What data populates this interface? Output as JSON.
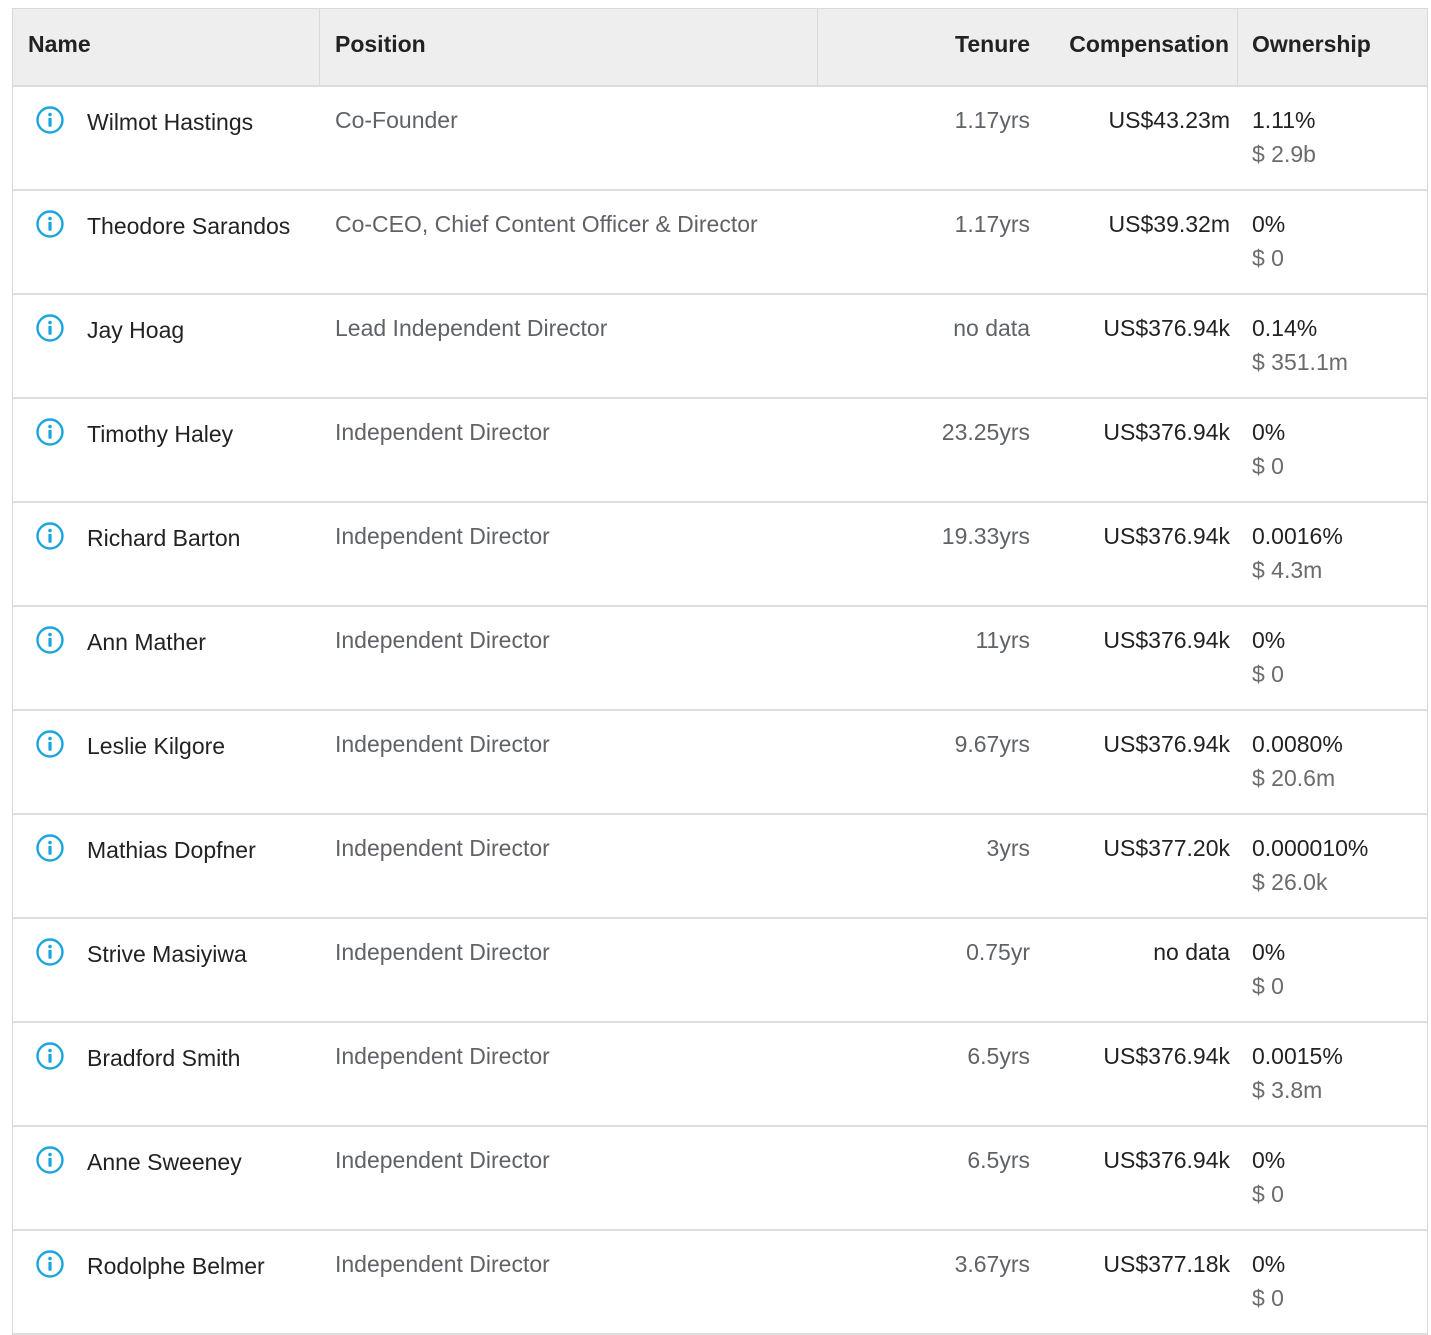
{
  "columns": {
    "name": "Name",
    "position": "Position",
    "tenure": "Tenure",
    "compensation": "Compensation",
    "ownership": "Ownership"
  },
  "colors": {
    "info_icon": "#1ca5dc"
  },
  "icons": {
    "info": "info-circle-icon"
  },
  "rows": [
    {
      "name": "Wilmot Hastings",
      "position": "Co-Founder",
      "tenure": "1.17yrs",
      "compensation": "US$43.23m",
      "ownership_pct": "1.11%",
      "ownership_value": "$ 2.9b"
    },
    {
      "name": "Theodore Sarandos",
      "position": "Co-CEO, Chief Content Officer & Director",
      "tenure": "1.17yrs",
      "compensation": "US$39.32m",
      "ownership_pct": "0%",
      "ownership_value": "$ 0"
    },
    {
      "name": "Jay Hoag",
      "position": "Lead Independent Director",
      "tenure": "no data",
      "compensation": "US$376.94k",
      "ownership_pct": "0.14%",
      "ownership_value": "$ 351.1m"
    },
    {
      "name": "Timothy Haley",
      "position": "Independent Director",
      "tenure": "23.25yrs",
      "compensation": "US$376.94k",
      "ownership_pct": "0%",
      "ownership_value": "$ 0"
    },
    {
      "name": "Richard Barton",
      "position": "Independent Director",
      "tenure": "19.33yrs",
      "compensation": "US$376.94k",
      "ownership_pct": "0.0016%",
      "ownership_value": "$ 4.3m"
    },
    {
      "name": "Ann Mather",
      "position": "Independent Director",
      "tenure": "11yrs",
      "compensation": "US$376.94k",
      "ownership_pct": "0%",
      "ownership_value": "$ 0"
    },
    {
      "name": "Leslie Kilgore",
      "position": "Independent Director",
      "tenure": "9.67yrs",
      "compensation": "US$376.94k",
      "ownership_pct": "0.0080%",
      "ownership_value": "$ 20.6m"
    },
    {
      "name": "Mathias Dopfner",
      "position": "Independent Director",
      "tenure": "3yrs",
      "compensation": "US$377.20k",
      "ownership_pct": "0.000010%",
      "ownership_value": "$ 26.0k"
    },
    {
      "name": "Strive Masiyiwa",
      "position": "Independent Director",
      "tenure": "0.75yr",
      "compensation": "no data",
      "ownership_pct": "0%",
      "ownership_value": "$ 0"
    },
    {
      "name": "Bradford Smith",
      "position": "Independent Director",
      "tenure": "6.5yrs",
      "compensation": "US$376.94k",
      "ownership_pct": "0.0015%",
      "ownership_value": "$ 3.8m"
    },
    {
      "name": "Anne Sweeney",
      "position": "Independent Director",
      "tenure": "6.5yrs",
      "compensation": "US$376.94k",
      "ownership_pct": "0%",
      "ownership_value": "$ 0"
    },
    {
      "name": "Rodolphe Belmer",
      "position": "Independent Director",
      "tenure": "3.67yrs",
      "compensation": "US$377.18k",
      "ownership_pct": "0%",
      "ownership_value": "$ 0"
    }
  ]
}
